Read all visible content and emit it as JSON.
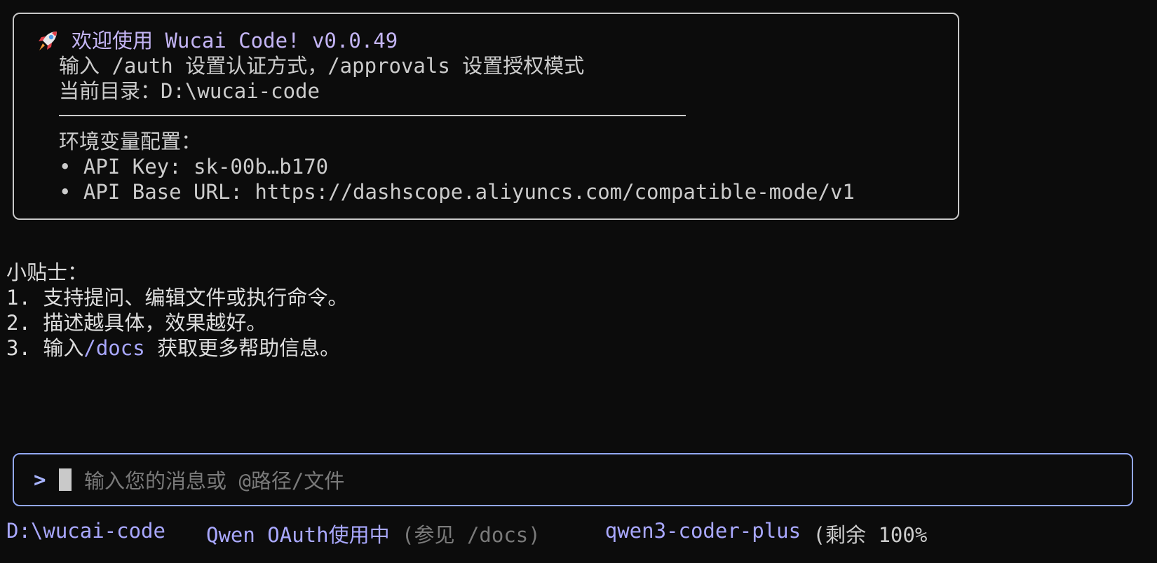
{
  "welcome": {
    "title": "欢迎使用 Wucai Code! v0.0.49",
    "line1": "输入 /auth 设置认证方式，/approvals 设置授权模式",
    "line2": "当前目录：D:\\wucai-code",
    "env_heading": "环境变量配置：",
    "env_items": [
      "• API Key: sk-00b…b170",
      "• API Base URL: https://dashscope.aliyuncs.com/compatible-mode/v1"
    ]
  },
  "tips": {
    "heading": "小贴士：",
    "item1": "1. 支持提问、编辑文件或执行命令。",
    "item2": "2. 描述越具体，效果越好。",
    "item3_prefix": "3. 输入",
    "item3_link": "/docs",
    "item3_suffix": " 获取更多帮助信息。"
  },
  "input": {
    "prompt": ">",
    "placeholder": "输入您的消息或 @路径/文件"
  },
  "status": {
    "path": "D:\\wucai-code",
    "auth": "Qwen OAuth使用中",
    "auth_note": " (参见 /docs)",
    "model": "qwen3-coder-plus",
    "context": " (剩余 100%"
  },
  "icons": {
    "rocket": "rocket-icon",
    "prompt": "chevron-right-icon"
  },
  "colors": {
    "accent": "#a9a8ff",
    "input_border": "#93a8f2",
    "background": "#0c0c0c"
  }
}
